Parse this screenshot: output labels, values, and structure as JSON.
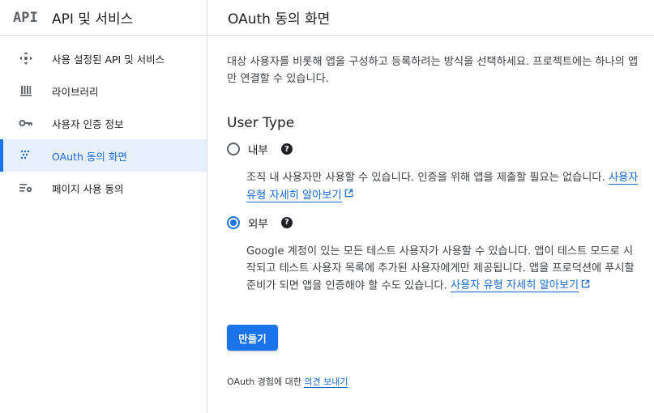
{
  "sidebar": {
    "logo": "API",
    "title": "API 및 서비스",
    "items": [
      {
        "label": "사용 설정된 API 및 서비스",
        "icon": "diamond-dots-icon"
      },
      {
        "label": "라이브러리",
        "icon": "library-icon"
      },
      {
        "label": "사용자 인증 정보",
        "icon": "key-icon"
      },
      {
        "label": "OAuth 동의 화면",
        "icon": "consent-dots-icon",
        "active": true
      },
      {
        "label": "페이지 사용 동의",
        "icon": "settings-list-icon"
      }
    ]
  },
  "main": {
    "title": "OAuth 동의 화면",
    "intro": "대상 사용자를 비롯해 앱을 구성하고 등록하려는 방식을 선택하세요. 프로젝트에는 하나의 앱만 연결할 수 있습니다.",
    "user_type_heading": "User Type",
    "options": [
      {
        "label": "내부",
        "checked": false,
        "description": "조직 내 사용자만 사용할 수 있습니다. 인증을 위해 앱을 제출할 필요는 없습니다.",
        "link": "사용자 유형 자세히 알아보기"
      },
      {
        "label": "외부",
        "checked": true,
        "description": "Google 계정이 있는 모든 테스트 사용자가 사용할 수 있습니다. 앱이 테스트 모드로 시작되고 테스트 사용자 목록에 추가된 사용자에게만 제공됩니다. 앱을 프로덕션에 푸시할 준비가 되면 앱을 인증해야 할 수도 있습니다.",
        "link": "사용자 유형 자세히 알아보기"
      }
    ],
    "create_button": "만들기",
    "feedback_prefix": "OAuth 경험에 대한",
    "feedback_link": "의견 보내기"
  },
  "colors": {
    "accent": "#1a73e8",
    "active_bg": "#e8f0fe",
    "link": "#1967d2"
  }
}
